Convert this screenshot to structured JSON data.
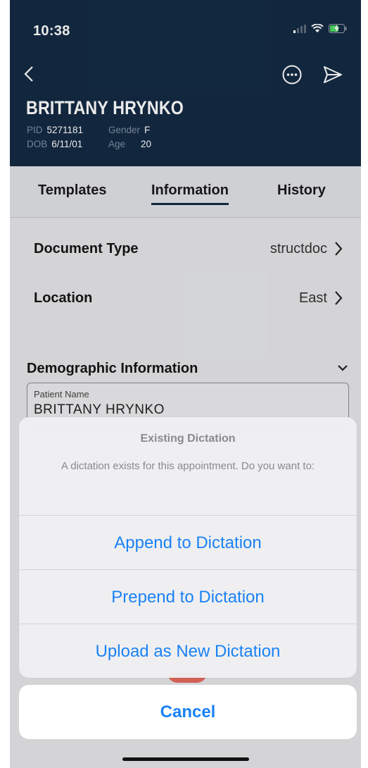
{
  "status_bar": {
    "time": "10:38"
  },
  "header": {
    "patient_name": "BRITTANY HRYNKO",
    "pid_label": "PID",
    "pid_value": "5271181",
    "gender_label": "Gender",
    "gender_value": "F",
    "dob_label": "DOB",
    "dob_value": "6/11/01",
    "age_label": "Age",
    "age_value": "20"
  },
  "tabs": [
    {
      "label": "Templates",
      "active": false
    },
    {
      "label": "Information",
      "active": true
    },
    {
      "label": "History",
      "active": false
    }
  ],
  "form": {
    "document_type_label": "Document Type",
    "document_type_value": "structdoc",
    "location_label": "Location",
    "location_value": "East",
    "section_title": "Demographic Information",
    "patient_name_label": "Patient Name",
    "patient_name_value": "BRITTANY HRYNKO"
  },
  "action_sheet": {
    "title": "Existing Dictation",
    "message": "A dictation exists for this appointment. Do you want to:",
    "buttons": [
      "Append to Dictation",
      "Prepend to Dictation",
      "Upload as New Dictation"
    ],
    "cancel": "Cancel"
  },
  "colors": {
    "header_bg": "#142b44",
    "accent": "#1a82f5"
  },
  "icons": [
    "signal-icon",
    "wifi-icon",
    "battery-charging-icon",
    "back-chevron-icon",
    "more-options-icon",
    "send-icon",
    "chevron-right-icon",
    "chevron-down-icon"
  ]
}
